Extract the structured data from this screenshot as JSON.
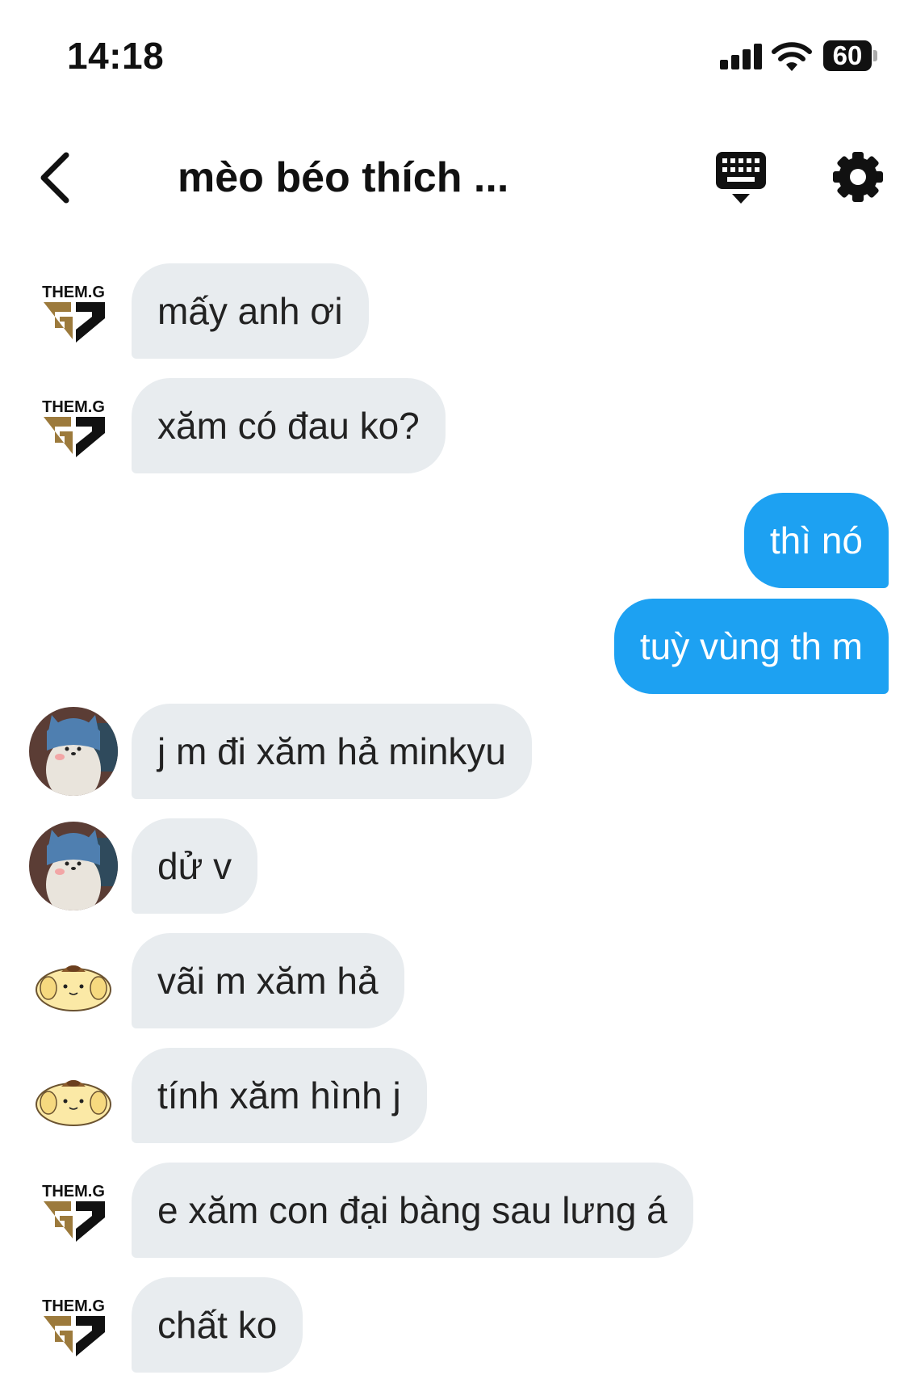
{
  "status_bar": {
    "time": "14:18",
    "battery": "60"
  },
  "header": {
    "title": "mèo béo thích ..."
  },
  "messages": [
    {
      "text": "mấy anh ơi",
      "avatar": "them-g-logo"
    },
    {
      "text": "xăm có đau ko?",
      "avatar": "them-g-logo"
    },
    {
      "text": "thì nó",
      "avatar": null
    },
    {
      "text": "tuỳ vùng th m",
      "avatar": null
    },
    {
      "text": "j m đi xăm hả minkyu",
      "avatar": "seal-cat-avatar"
    },
    {
      "text": "dử v",
      "avatar": "seal-cat-avatar"
    },
    {
      "text": "vãi m xăm hả",
      "avatar": "pompompurin-avatar"
    },
    {
      "text": "tính xăm hình j",
      "avatar": "pompompurin-avatar"
    },
    {
      "text": "e xăm con đại bàng sau lưng á",
      "avatar": "them-g-logo"
    },
    {
      "text": "chất ko",
      "avatar": "them-g-logo"
    }
  ],
  "logo_text": "THEM.G",
  "colors": {
    "outgoing": "#1da1f2",
    "incoming": "#e8ecef",
    "logo_gold": "#9c7a3c"
  }
}
